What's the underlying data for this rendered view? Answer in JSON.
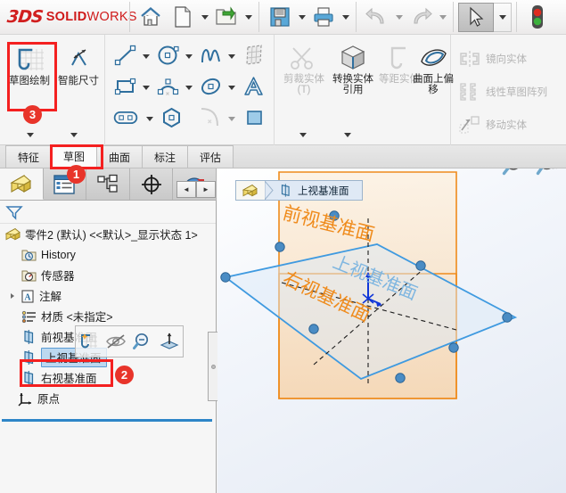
{
  "app": {
    "brand_3ds": "3DS",
    "brand_name_bold": "SOLID",
    "brand_name_light": "WORKS"
  },
  "menubar": {
    "items": [
      {
        "name": "home-icon",
        "label": "主页"
      },
      {
        "name": "new-document-icon",
        "label": "新建"
      },
      {
        "name": "open-document-icon",
        "label": "打开"
      },
      {
        "name": "save-icon",
        "label": "保存"
      },
      {
        "name": "print-icon",
        "label": "打印"
      },
      {
        "name": "undo-icon",
        "label": "撤销"
      },
      {
        "name": "redo-icon",
        "label": "重做"
      },
      {
        "name": "select-arrow-icon",
        "label": "选择"
      },
      {
        "name": "traffic-light-icon",
        "label": "状态"
      }
    ]
  },
  "ribbon": {
    "group1": [
      {
        "label": "草图绘制",
        "icon": "sketch-icon",
        "disabled": false
      },
      {
        "label": "智能尺寸",
        "icon": "smart-dimension-icon",
        "disabled": false
      }
    ],
    "group2": [
      {
        "icon": "line-icon",
        "label": "直线"
      },
      {
        "icon": "circle-icon",
        "label": "圆"
      },
      {
        "icon": "spline-icon",
        "label": "样条曲线"
      },
      {
        "icon": "surface-curve-icon",
        "label": "曲面上样条曲线"
      },
      {
        "icon": "rectangle-icon",
        "label": "边角矩形"
      },
      {
        "icon": "arc-icon",
        "label": "圆弧"
      },
      {
        "icon": "ellipse-icon",
        "label": "椭圆"
      },
      {
        "icon": "text-icon",
        "label": "文字"
      },
      {
        "icon": "slot-icon",
        "label": "直槽口"
      },
      {
        "icon": "polygon-icon",
        "label": "多边形"
      },
      {
        "icon": "fillet-icon",
        "label": "绘制圆角"
      },
      {
        "icon": "plane-icon",
        "label": "基准面"
      }
    ],
    "group3": [
      {
        "label": "剪裁实体(T)",
        "icon": "trim-entities-icon",
        "disabled": true
      },
      {
        "label": "转换实体引用",
        "icon": "convert-entities-icon",
        "disabled": false
      },
      {
        "label": "等距实体",
        "icon": "offset-entities-icon",
        "disabled": true
      },
      {
        "label": "曲面上偏移",
        "icon": "offset-on-surface-icon",
        "disabled": false
      }
    ],
    "group4": [
      {
        "label": "镜向实体",
        "icon": "mirror-entities-icon",
        "disabled": true
      },
      {
        "label": "线性草图阵列",
        "icon": "linear-sketch-pattern-icon",
        "disabled": true
      },
      {
        "label": "移动实体",
        "icon": "move-entities-icon",
        "disabled": true
      }
    ]
  },
  "tabs": [
    {
      "label": "特征",
      "active": false
    },
    {
      "label": "草图",
      "active": true
    },
    {
      "label": "曲面",
      "active": false
    },
    {
      "label": "标注",
      "active": false
    },
    {
      "label": "评估",
      "active": false
    }
  ],
  "feature_manager": {
    "tabs": [
      {
        "name": "feature-tree-tab",
        "active": true
      },
      {
        "name": "property-manager-tab",
        "active": false
      },
      {
        "name": "configuration-manager-tab",
        "active": false
      },
      {
        "name": "dimxpert-manager-tab",
        "active": false
      },
      {
        "name": "display-manager-tab",
        "active": false
      }
    ],
    "nav_prev": "◄",
    "nav_next": "►",
    "filter_placeholder": "",
    "tree": [
      {
        "label": "零件2 (默认) <<默认>_显示状态 1>",
        "icon": "part-icon",
        "indent": 0,
        "twisty": false,
        "selected": false
      },
      {
        "label": "History",
        "icon": "history-icon",
        "indent": 1,
        "twisty": false,
        "selected": false
      },
      {
        "label": "传感器",
        "icon": "sensors-icon",
        "indent": 1,
        "twisty": false,
        "selected": false
      },
      {
        "label": "注解",
        "icon": "annotations-icon",
        "indent": 1,
        "twisty": true,
        "selected": false
      },
      {
        "label": "材质 <未指定>",
        "icon": "material-icon",
        "indent": 1,
        "twisty": false,
        "selected": false
      },
      {
        "label": "前视基准面",
        "icon": "plane-icon",
        "indent": 1,
        "twisty": false,
        "selected": false
      },
      {
        "label": "上视基准面",
        "icon": "plane-icon",
        "indent": 1,
        "twisty": false,
        "selected": true
      },
      {
        "label": "右视基准面",
        "icon": "plane-icon",
        "indent": 1,
        "twisty": false,
        "selected": false
      },
      {
        "label": "原点",
        "icon": "origin-icon",
        "indent": 1,
        "twisty": false,
        "selected": false
      }
    ],
    "context_toolbar": [
      {
        "name": "sketch-on-plane-icon",
        "label": "草图绘制"
      },
      {
        "name": "hide-show-icon",
        "label": "隐藏/显示"
      },
      {
        "name": "zoom-to-selection-icon",
        "label": "局部放大"
      },
      {
        "name": "normal-to-icon",
        "label": "正视于"
      }
    ]
  },
  "graphics": {
    "breadcrumb_label": "上视基准面",
    "zoom_tools": [
      {
        "name": "zoom-to-fit-icon",
        "label": "整屏显示全图"
      },
      {
        "name": "zoom-to-area-icon",
        "label": "局部放大"
      }
    ],
    "plane_labels": {
      "front": "前视基准面",
      "top": "上视基准面",
      "right": "右视基准面"
    },
    "colors": {
      "plane_orange": "#ef8b1c",
      "plane_orange_fill": "#f7d6b0",
      "selected_blue": "#3f9ae0",
      "selected_blue_fill": "#cfe4f7",
      "handle_blue": "#3f7fbf",
      "origin_blue": "#1136d8"
    }
  },
  "annotations": [
    {
      "badge": "1",
      "target": "tab-sketch"
    },
    {
      "badge": "2",
      "target": "tree-item-top-plane"
    },
    {
      "badge": "3",
      "target": "ribbon-sketch-button"
    }
  ]
}
